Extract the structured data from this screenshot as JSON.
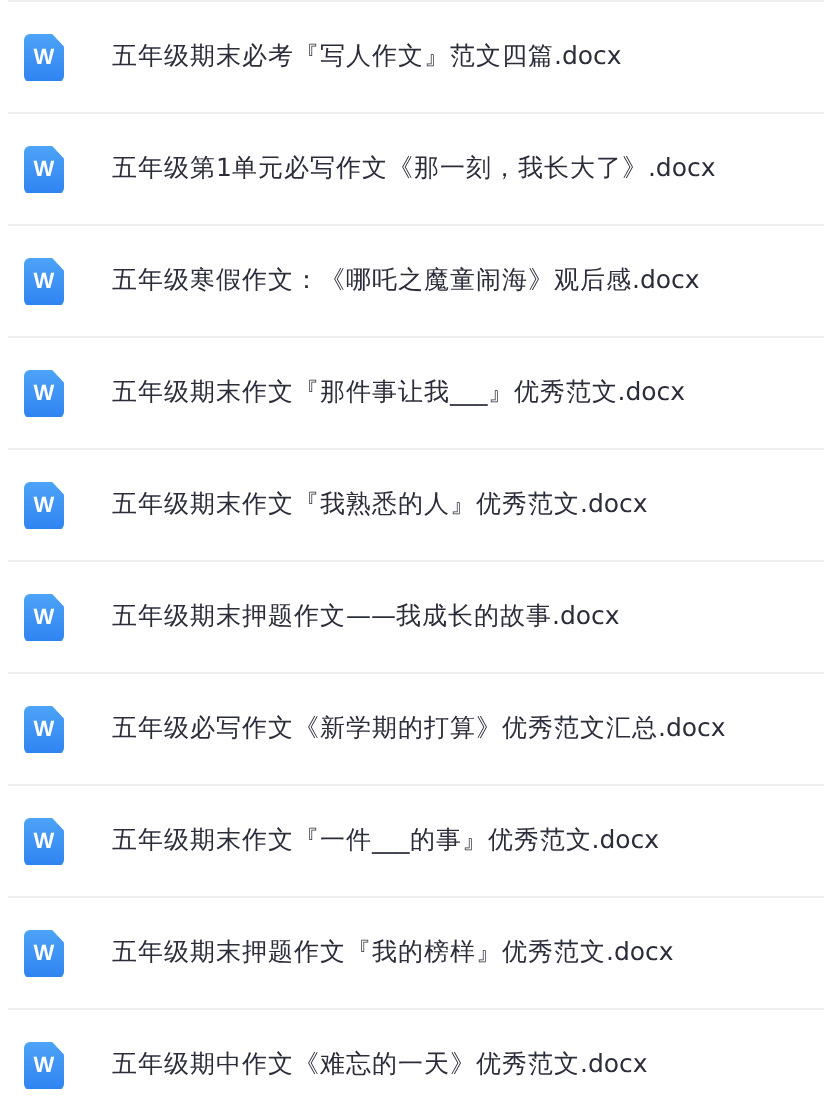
{
  "files": [
    {
      "icon_label": "W",
      "name": "五年级期末必考『写人作文』范文四篇.docx"
    },
    {
      "icon_label": "W",
      "name": "五年级第1单元必写作文《那一刻，我长大了》.docx"
    },
    {
      "icon_label": "W",
      "name": "五年级寒假作文：《哪吒之魔童闹海》观后感.docx"
    },
    {
      "icon_label": "W",
      "name": "五年级期末作文『那件事让我___』优秀范文.docx"
    },
    {
      "icon_label": "W",
      "name": "五年级期末作文『我熟悉的人』优秀范文.docx"
    },
    {
      "icon_label": "W",
      "name": "五年级期末押题作文——我成长的故事.docx"
    },
    {
      "icon_label": "W",
      "name": "五年级必写作文《新学期的打算》优秀范文汇总.docx"
    },
    {
      "icon_label": "W",
      "name": "五年级期末作文『一件___的事』优秀范文.docx"
    },
    {
      "icon_label": "W",
      "name": "五年级期末押题作文『我的榜样』优秀范文.docx"
    },
    {
      "icon_label": "W",
      "name": "五年级期中作文《难忘的一天》优秀范文.docx"
    }
  ]
}
